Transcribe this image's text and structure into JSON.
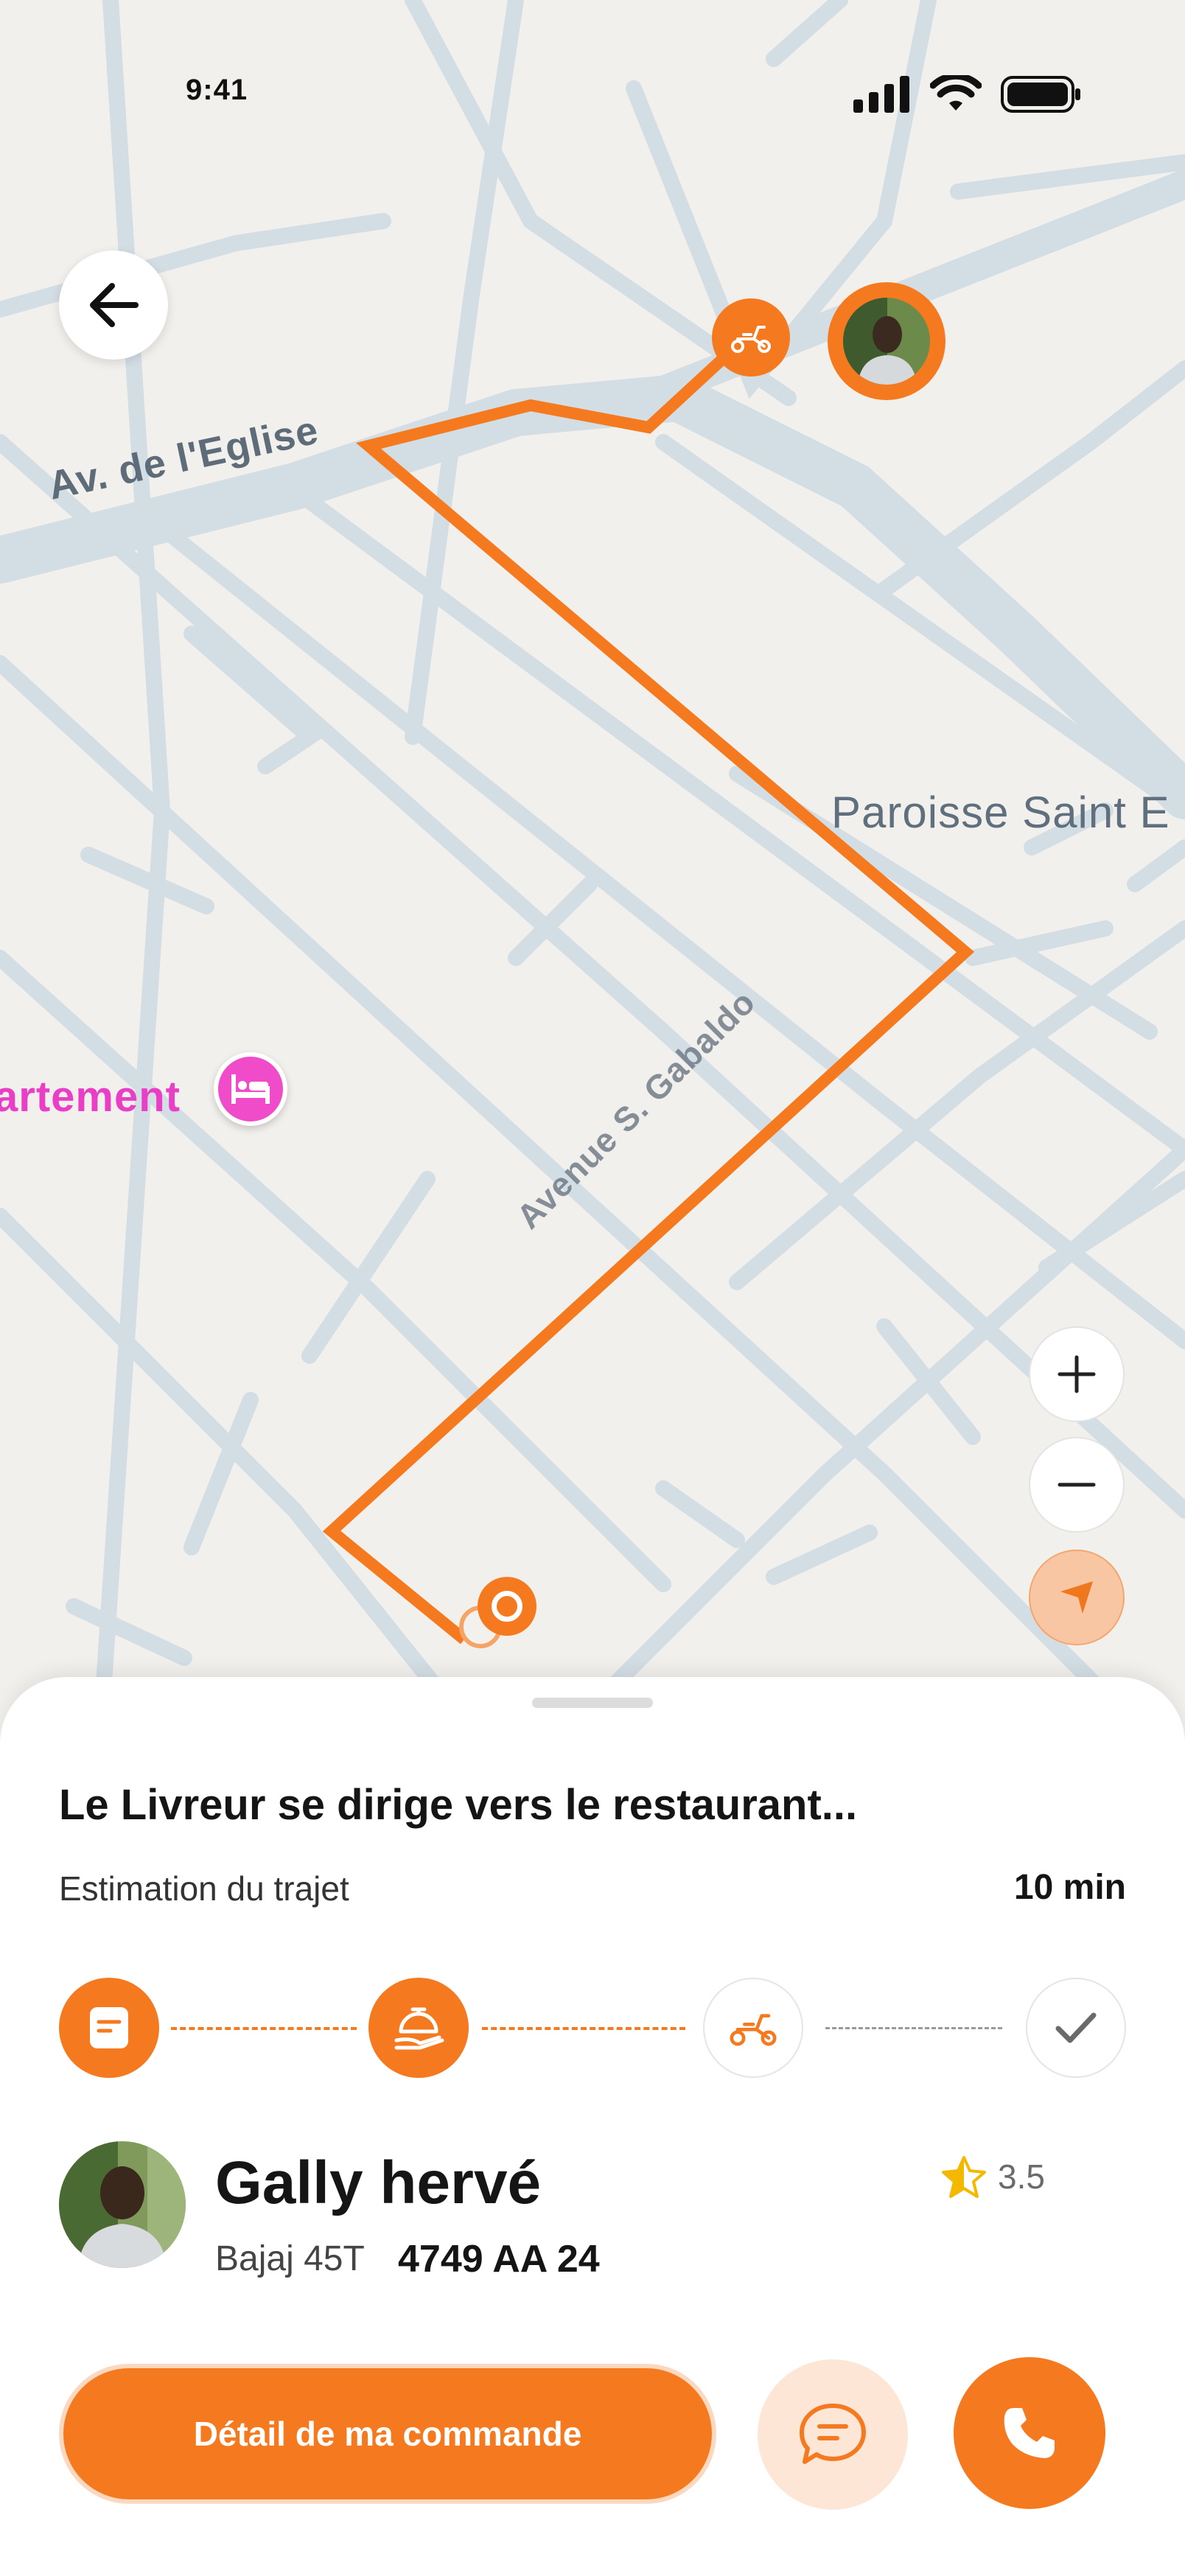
{
  "status_bar": {
    "time": "9:41"
  },
  "map": {
    "labels": {
      "avenue": "Av. de l'Eglise",
      "paroisse": "Paroisse Saint E",
      "street": "Avenue S. Gabaldo",
      "appartement": "artement"
    },
    "icons": [
      "back-arrow-icon",
      "scooter-icon",
      "hotel-icon",
      "zoom-in-icon",
      "zoom-out-icon",
      "locate-icon"
    ],
    "controls": {
      "zoom_in": "+",
      "zoom_out": "−"
    }
  },
  "sheet": {
    "status_title": "Le Livreur se dirige vers le restaurant...",
    "eta_label": "Estimation du trajet",
    "eta_value": "10 min",
    "steps": [
      {
        "name": "order",
        "state": "done"
      },
      {
        "name": "restaurant",
        "state": "done"
      },
      {
        "name": "delivery",
        "state": "todo"
      },
      {
        "name": "completed",
        "state": "todo"
      }
    ],
    "driver": {
      "name": "Gally hervé",
      "vehicle": "Bajaj 45T",
      "plate": "4749 AA 24",
      "rating": "3.5"
    },
    "detail_button": "Détail de ma commande"
  },
  "colors": {
    "accent": "#f57a1f",
    "accent_light": "#fde6d6",
    "road": "#d3dde4",
    "poi": "#e93fc6"
  }
}
